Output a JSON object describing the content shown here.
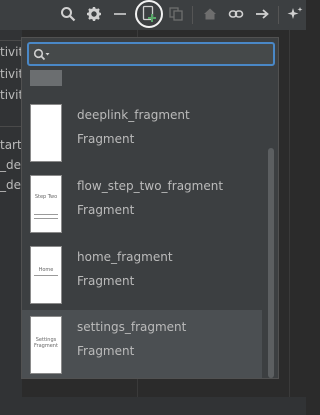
{
  "toolbar": {
    "icons": [
      "search-icon",
      "gear-icon",
      "minimize-icon",
      "new-destination-icon",
      "copy-icon",
      "home-icon",
      "link-icon",
      "arrow-right-icon",
      "auto-arrange-icon"
    ]
  },
  "left_panel": {
    "items": [
      "tivit",
      "tivit",
      "tivit",
      "tart",
      "_de",
      "_de"
    ]
  },
  "search": {
    "placeholder": "",
    "value": ""
  },
  "destinations": [
    {
      "name": "deeplink_fragment",
      "kind": "Fragment",
      "thumb_text": ""
    },
    {
      "name": "flow_step_two_fragment",
      "kind": "Fragment",
      "thumb_text": "Step Two"
    },
    {
      "name": "home_fragment",
      "kind": "Fragment",
      "thumb_text": "Home"
    },
    {
      "name": "settings_fragment",
      "kind": "Fragment",
      "thumb_text": "Settings Fragment"
    }
  ],
  "colors": {
    "accent": "#4a88c7",
    "selected": "#4b4f52",
    "add_icon": "#59a869"
  }
}
